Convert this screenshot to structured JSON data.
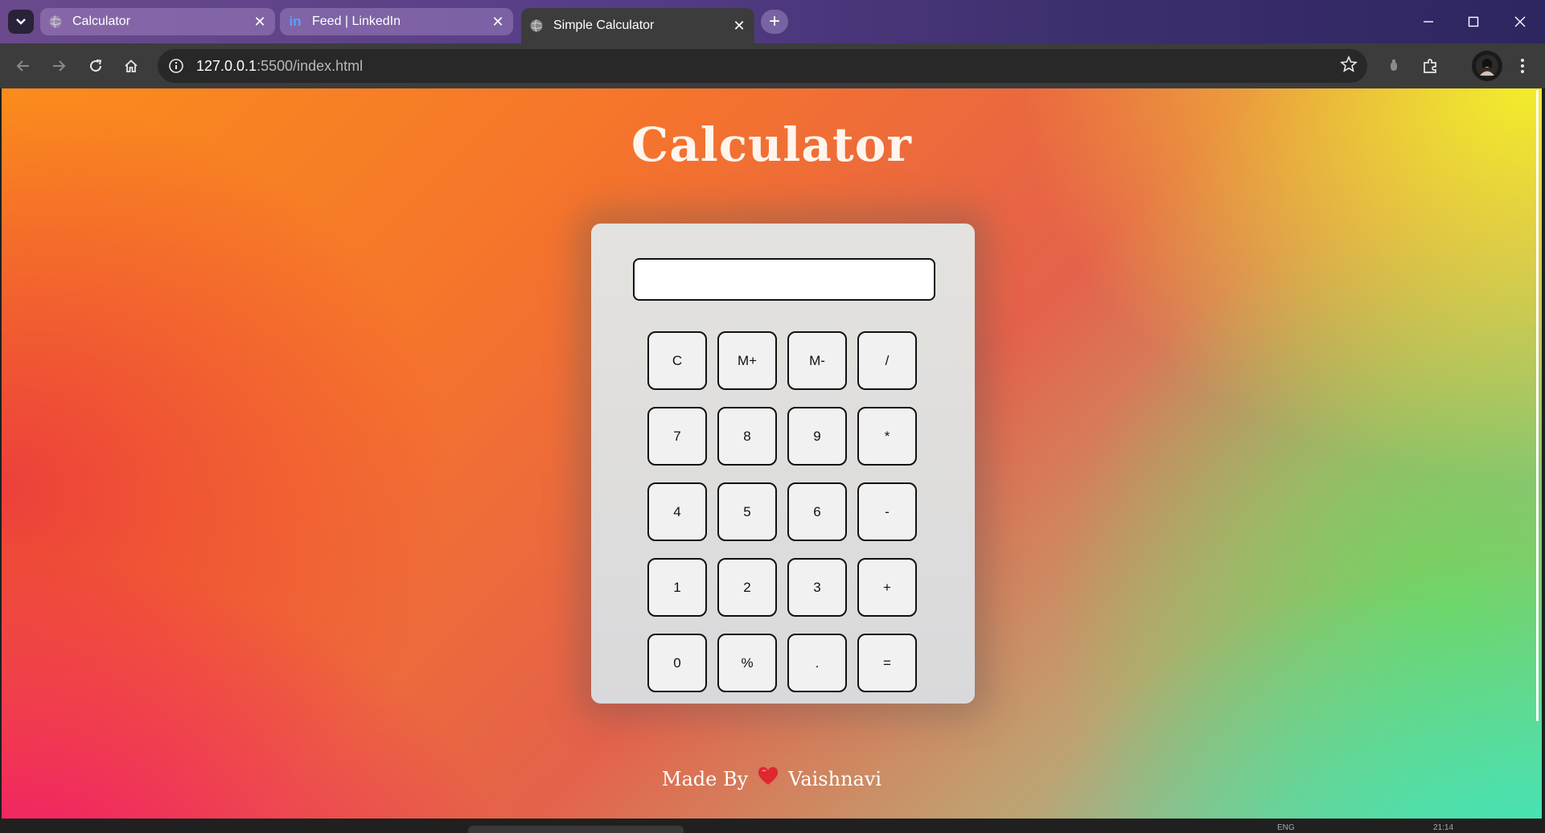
{
  "browser": {
    "tabs": [
      {
        "title": "Calculator",
        "icon": "globe-icon",
        "active": false
      },
      {
        "title": "Feed | LinkedIn",
        "icon": "linkedin-icon",
        "active": false
      },
      {
        "title": "Simple Calculator",
        "icon": "globe-icon",
        "active": true
      }
    ],
    "close_glyph": "✕",
    "new_tab_glyph": "+",
    "address": {
      "host": "127.0.0.1",
      "path": ":5500/index.html"
    },
    "linkedin_glyph": "in"
  },
  "page": {
    "title": "Calculator",
    "display_value": "",
    "keys": [
      [
        "C",
        "M+",
        "M-",
        "/"
      ],
      [
        "7",
        "8",
        "9",
        "*"
      ],
      [
        "4",
        "5",
        "6",
        "-"
      ],
      [
        "1",
        "2",
        "3",
        "+"
      ],
      [
        "0",
        "%",
        ".",
        "="
      ]
    ],
    "footer": {
      "prefix": "Made By",
      "name": "Vaishnavi",
      "icon": "heart-icon"
    }
  },
  "taskbar": {
    "lang": "ENG",
    "time": "21:14"
  },
  "colors": {
    "accent_heart": "#e0262f",
    "tab_active_bg": "#3c3c3c",
    "calc_bg": "#e0dfdc"
  }
}
